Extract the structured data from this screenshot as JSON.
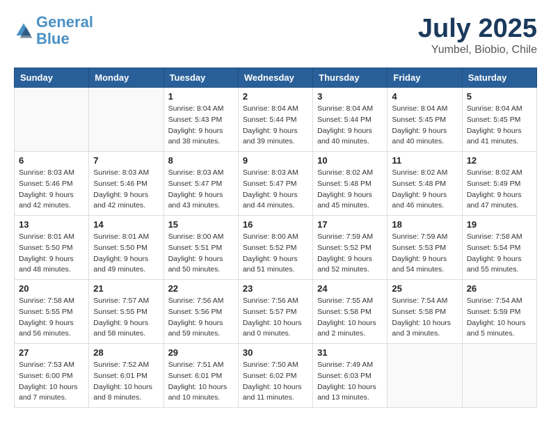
{
  "header": {
    "logo_line1": "General",
    "logo_line2": "Blue",
    "month": "July 2025",
    "location": "Yumbel, Biobio, Chile"
  },
  "days_of_week": [
    "Sunday",
    "Monday",
    "Tuesday",
    "Wednesday",
    "Thursday",
    "Friday",
    "Saturday"
  ],
  "weeks": [
    [
      {
        "day": "",
        "sunrise": "",
        "sunset": "",
        "daylight": ""
      },
      {
        "day": "",
        "sunrise": "",
        "sunset": "",
        "daylight": ""
      },
      {
        "day": "1",
        "sunrise": "Sunrise: 8:04 AM",
        "sunset": "Sunset: 5:43 PM",
        "daylight": "Daylight: 9 hours and 38 minutes."
      },
      {
        "day": "2",
        "sunrise": "Sunrise: 8:04 AM",
        "sunset": "Sunset: 5:44 PM",
        "daylight": "Daylight: 9 hours and 39 minutes."
      },
      {
        "day": "3",
        "sunrise": "Sunrise: 8:04 AM",
        "sunset": "Sunset: 5:44 PM",
        "daylight": "Daylight: 9 hours and 40 minutes."
      },
      {
        "day": "4",
        "sunrise": "Sunrise: 8:04 AM",
        "sunset": "Sunset: 5:45 PM",
        "daylight": "Daylight: 9 hours and 40 minutes."
      },
      {
        "day": "5",
        "sunrise": "Sunrise: 8:04 AM",
        "sunset": "Sunset: 5:45 PM",
        "daylight": "Daylight: 9 hours and 41 minutes."
      }
    ],
    [
      {
        "day": "6",
        "sunrise": "Sunrise: 8:03 AM",
        "sunset": "Sunset: 5:46 PM",
        "daylight": "Daylight: 9 hours and 42 minutes."
      },
      {
        "day": "7",
        "sunrise": "Sunrise: 8:03 AM",
        "sunset": "Sunset: 5:46 PM",
        "daylight": "Daylight: 9 hours and 42 minutes."
      },
      {
        "day": "8",
        "sunrise": "Sunrise: 8:03 AM",
        "sunset": "Sunset: 5:47 PM",
        "daylight": "Daylight: 9 hours and 43 minutes."
      },
      {
        "day": "9",
        "sunrise": "Sunrise: 8:03 AM",
        "sunset": "Sunset: 5:47 PM",
        "daylight": "Daylight: 9 hours and 44 minutes."
      },
      {
        "day": "10",
        "sunrise": "Sunrise: 8:02 AM",
        "sunset": "Sunset: 5:48 PM",
        "daylight": "Daylight: 9 hours and 45 minutes."
      },
      {
        "day": "11",
        "sunrise": "Sunrise: 8:02 AM",
        "sunset": "Sunset: 5:48 PM",
        "daylight": "Daylight: 9 hours and 46 minutes."
      },
      {
        "day": "12",
        "sunrise": "Sunrise: 8:02 AM",
        "sunset": "Sunset: 5:49 PM",
        "daylight": "Daylight: 9 hours and 47 minutes."
      }
    ],
    [
      {
        "day": "13",
        "sunrise": "Sunrise: 8:01 AM",
        "sunset": "Sunset: 5:50 PM",
        "daylight": "Daylight: 9 hours and 48 minutes."
      },
      {
        "day": "14",
        "sunrise": "Sunrise: 8:01 AM",
        "sunset": "Sunset: 5:50 PM",
        "daylight": "Daylight: 9 hours and 49 minutes."
      },
      {
        "day": "15",
        "sunrise": "Sunrise: 8:00 AM",
        "sunset": "Sunset: 5:51 PM",
        "daylight": "Daylight: 9 hours and 50 minutes."
      },
      {
        "day": "16",
        "sunrise": "Sunrise: 8:00 AM",
        "sunset": "Sunset: 5:52 PM",
        "daylight": "Daylight: 9 hours and 51 minutes."
      },
      {
        "day": "17",
        "sunrise": "Sunrise: 7:59 AM",
        "sunset": "Sunset: 5:52 PM",
        "daylight": "Daylight: 9 hours and 52 minutes."
      },
      {
        "day": "18",
        "sunrise": "Sunrise: 7:59 AM",
        "sunset": "Sunset: 5:53 PM",
        "daylight": "Daylight: 9 hours and 54 minutes."
      },
      {
        "day": "19",
        "sunrise": "Sunrise: 7:58 AM",
        "sunset": "Sunset: 5:54 PM",
        "daylight": "Daylight: 9 hours and 55 minutes."
      }
    ],
    [
      {
        "day": "20",
        "sunrise": "Sunrise: 7:58 AM",
        "sunset": "Sunset: 5:55 PM",
        "daylight": "Daylight: 9 hours and 56 minutes."
      },
      {
        "day": "21",
        "sunrise": "Sunrise: 7:57 AM",
        "sunset": "Sunset: 5:55 PM",
        "daylight": "Daylight: 9 hours and 58 minutes."
      },
      {
        "day": "22",
        "sunrise": "Sunrise: 7:56 AM",
        "sunset": "Sunset: 5:56 PM",
        "daylight": "Daylight: 9 hours and 59 minutes."
      },
      {
        "day": "23",
        "sunrise": "Sunrise: 7:56 AM",
        "sunset": "Sunset: 5:57 PM",
        "daylight": "Daylight: 10 hours and 0 minutes."
      },
      {
        "day": "24",
        "sunrise": "Sunrise: 7:55 AM",
        "sunset": "Sunset: 5:58 PM",
        "daylight": "Daylight: 10 hours and 2 minutes."
      },
      {
        "day": "25",
        "sunrise": "Sunrise: 7:54 AM",
        "sunset": "Sunset: 5:58 PM",
        "daylight": "Daylight: 10 hours and 3 minutes."
      },
      {
        "day": "26",
        "sunrise": "Sunrise: 7:54 AM",
        "sunset": "Sunset: 5:59 PM",
        "daylight": "Daylight: 10 hours and 5 minutes."
      }
    ],
    [
      {
        "day": "27",
        "sunrise": "Sunrise: 7:53 AM",
        "sunset": "Sunset: 6:00 PM",
        "daylight": "Daylight: 10 hours and 7 minutes."
      },
      {
        "day": "28",
        "sunrise": "Sunrise: 7:52 AM",
        "sunset": "Sunset: 6:01 PM",
        "daylight": "Daylight: 10 hours and 8 minutes."
      },
      {
        "day": "29",
        "sunrise": "Sunrise: 7:51 AM",
        "sunset": "Sunset: 6:01 PM",
        "daylight": "Daylight: 10 hours and 10 minutes."
      },
      {
        "day": "30",
        "sunrise": "Sunrise: 7:50 AM",
        "sunset": "Sunset: 6:02 PM",
        "daylight": "Daylight: 10 hours and 11 minutes."
      },
      {
        "day": "31",
        "sunrise": "Sunrise: 7:49 AM",
        "sunset": "Sunset: 6:03 PM",
        "daylight": "Daylight: 10 hours and 13 minutes."
      },
      {
        "day": "",
        "sunrise": "",
        "sunset": "",
        "daylight": ""
      },
      {
        "day": "",
        "sunrise": "",
        "sunset": "",
        "daylight": ""
      }
    ]
  ]
}
